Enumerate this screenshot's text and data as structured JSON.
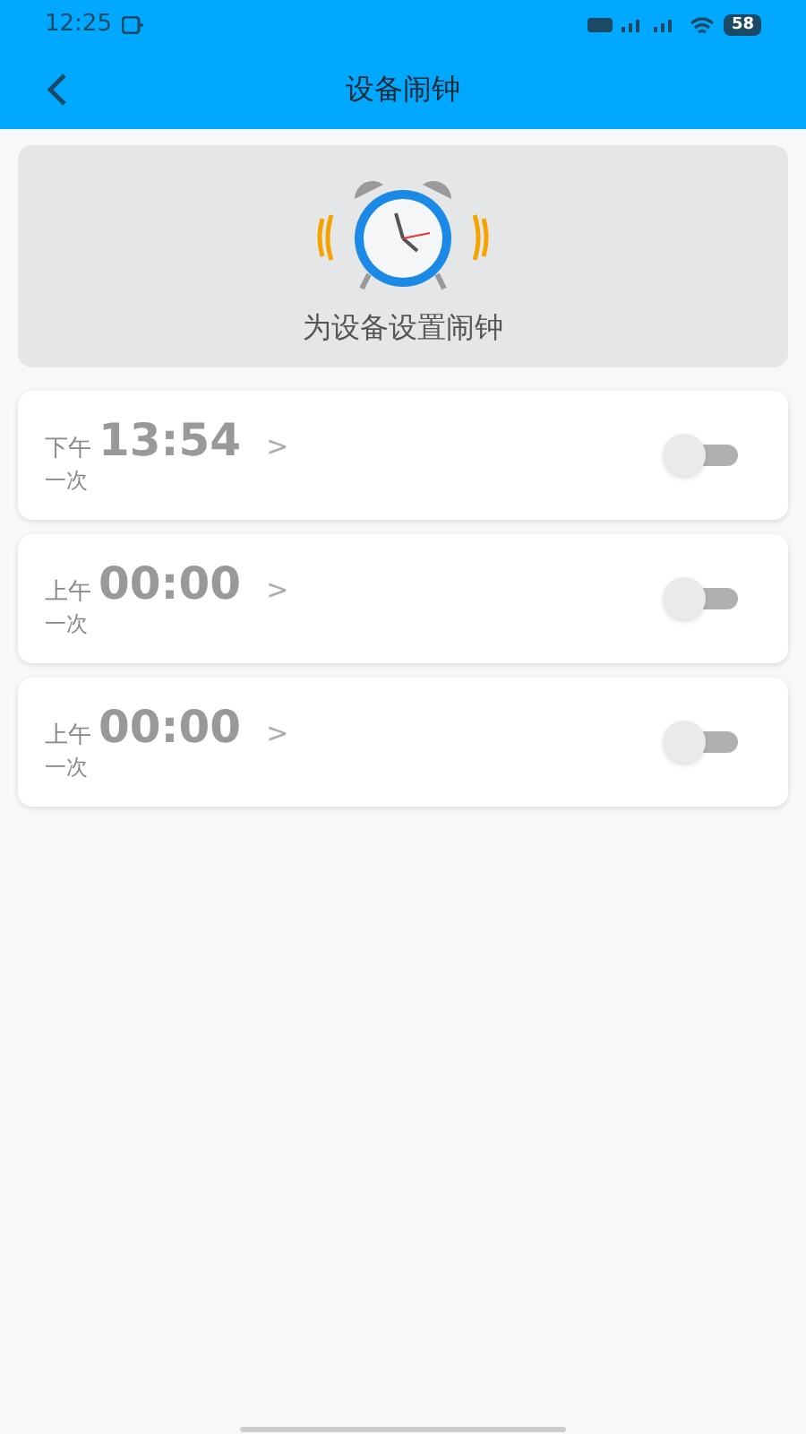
{
  "status_bar": {
    "time": "12:25",
    "battery": "58"
  },
  "header": {
    "title": "设备闹钟"
  },
  "banner": {
    "caption": "为设备设置闹钟"
  },
  "alarms": [
    {
      "period": "下午",
      "time": "13:54",
      "arrow": ">",
      "repeat": "一次",
      "on": false
    },
    {
      "period": "上午",
      "time": "00:00",
      "arrow": ">",
      "repeat": "一次",
      "on": false
    },
    {
      "period": "上午",
      "time": "00:00",
      "arrow": ">",
      "repeat": "一次",
      "on": false
    }
  ]
}
